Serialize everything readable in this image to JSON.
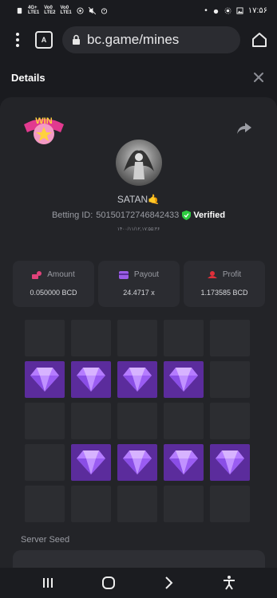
{
  "status_bar": {
    "time": "۱۷:۵۶",
    "net1_top": "4G+",
    "net1_bottom": "LTE1",
    "net2_top": "Vo0",
    "net2_bottom": "LTE2",
    "net3_top": "Vo0",
    "net3_bottom": "LTE1"
  },
  "browser": {
    "url": "bc.game/mines",
    "tab_label": "A"
  },
  "details": {
    "title": "Details"
  },
  "player": {
    "username": "SATAN🤙",
    "betting_id_label": "Betting ID:",
    "betting_id": "50150172746842433",
    "verified_label": "Verified",
    "date": "۱۴۰۰/۱۱/۱۲,۱۷:۵۵:۳۶"
  },
  "win_badge": {
    "text": "WIN"
  },
  "stats": [
    {
      "label": "Amount",
      "value": "0.050000 BCD",
      "icon": "coins-icon",
      "color": "#e0427a"
    },
    {
      "label": "Payout",
      "value": "24.4717 x",
      "icon": "wallet-icon",
      "color": "#9b5de5"
    },
    {
      "label": "Profit",
      "value": "1.173585 BCD",
      "icon": "profit-icon",
      "color": "#e0303a"
    }
  ],
  "grid": {
    "rows": 5,
    "cols": 5,
    "gem_color": "#5b2c9c",
    "empty_color": "#2c2d31",
    "cells": [
      0,
      0,
      0,
      0,
      0,
      1,
      1,
      1,
      1,
      0,
      0,
      0,
      0,
      0,
      0,
      0,
      1,
      1,
      1,
      1,
      0,
      0,
      0,
      0,
      0
    ]
  },
  "server_seed": {
    "label": "Server Seed"
  }
}
